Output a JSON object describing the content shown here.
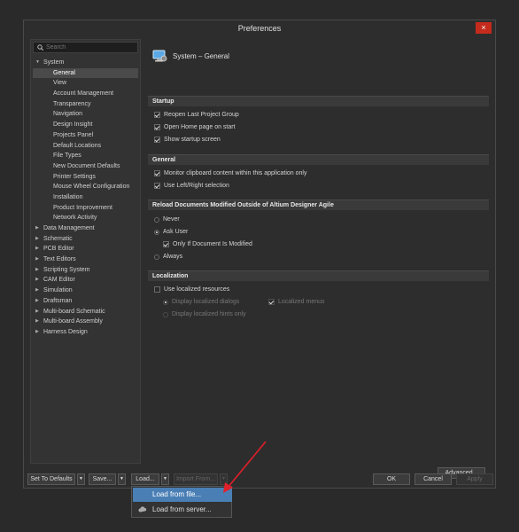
{
  "window": {
    "title": "Preferences",
    "close_icon": "×"
  },
  "sidebar": {
    "search_placeholder": "Search",
    "system": {
      "label": "System",
      "children": [
        "General",
        "View",
        "Account Management",
        "Transparency",
        "Navigation",
        "Design Insight",
        "Projects Panel",
        "Default Locations",
        "File Types",
        "New Document Defaults",
        "Printer Settings",
        "Mouse Wheel Configuration",
        "Installation",
        "Product Improvement",
        "Network Activity"
      ]
    },
    "others": [
      "Data Management",
      "Schematic",
      "PCB Editor",
      "Text Editors",
      "Scripting System",
      "CAM Editor",
      "Simulation",
      "Draftsman",
      "Multi-board Schematic",
      "Multi-board Assembly",
      "Harness Design"
    ]
  },
  "page": {
    "title": "System – General",
    "startup": {
      "header": "Startup",
      "options": [
        "Reopen Last Project Group",
        "Open Home page on start",
        "Show startup screen"
      ]
    },
    "general": {
      "header": "General",
      "options": [
        "Monitor clipboard content within this application only",
        "Use Left/Right selection"
      ]
    },
    "reload": {
      "header": "Reload Documents Modified Outside of Altium Designer Agile",
      "never": "Never",
      "ask": "Ask User",
      "only_if": "Only If Document Is Modified",
      "always": "Always"
    },
    "localization": {
      "header": "Localization",
      "use": "Use localized resources",
      "dialogs": "Display localized dialogs",
      "menus": "Localized menus",
      "hints": "Display localized hints only"
    },
    "advanced_button": "Advanced..."
  },
  "footer": {
    "set_defaults": "Set To Defaults",
    "save": "Save...",
    "load": "Load...",
    "import": "Import From...",
    "ok": "OK",
    "cancel": "Cancel",
    "apply": "Apply"
  },
  "load_menu": {
    "items": [
      "Load from file...",
      "Load from server..."
    ]
  },
  "colors": {
    "annotation_arrow": "#e0202a",
    "menu_highlight": "#4a7fb5",
    "close_button": "#c42b1c"
  }
}
